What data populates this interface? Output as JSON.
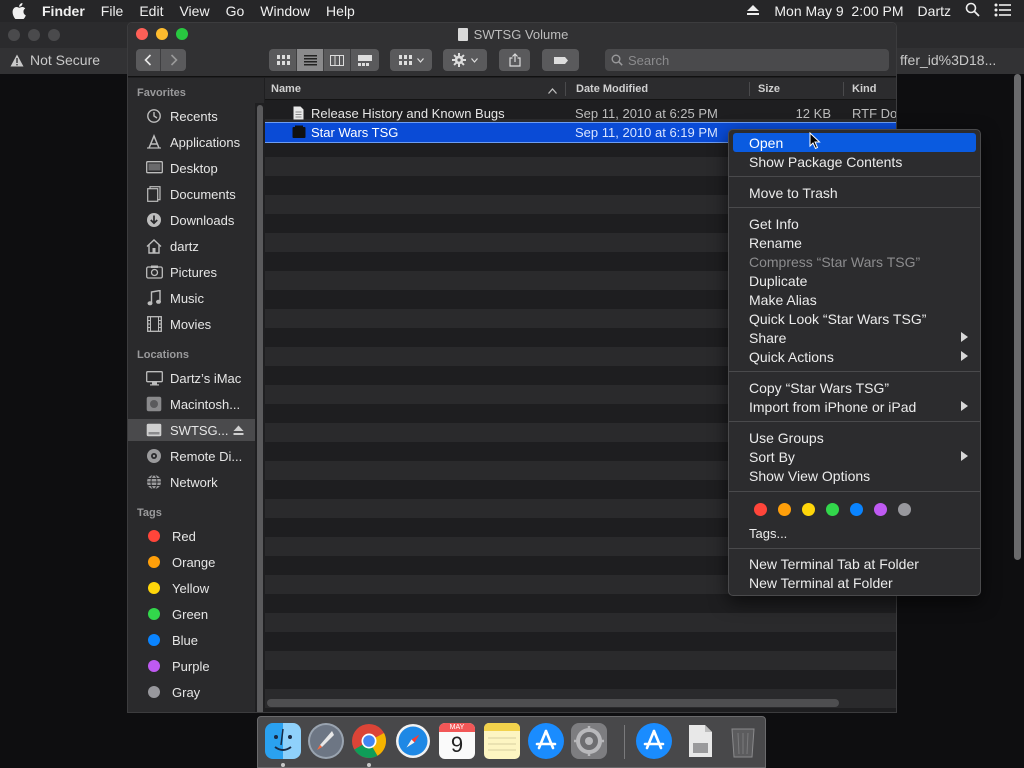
{
  "menubar": {
    "app": "Finder",
    "items": [
      "File",
      "Edit",
      "View",
      "Go",
      "Window",
      "Help"
    ],
    "datetime": "Mon May 9  2:00 PM",
    "user": "Dartz"
  },
  "browser": {
    "security": "Not Secure",
    "url_fragment": "ffer_id%3D18..."
  },
  "window": {
    "title": "SWTSG Volume",
    "search_placeholder": "Search"
  },
  "sidebar": {
    "favorites_label": "Favorites",
    "favorites": [
      {
        "label": "Recents",
        "icon": "recents-icon"
      },
      {
        "label": "Applications",
        "icon": "applications-icon"
      },
      {
        "label": "Desktop",
        "icon": "desktop-icon"
      },
      {
        "label": "Documents",
        "icon": "documents-icon"
      },
      {
        "label": "Downloads",
        "icon": "downloads-icon"
      },
      {
        "label": "dartz",
        "icon": "home-icon"
      },
      {
        "label": "Pictures",
        "icon": "pictures-icon"
      },
      {
        "label": "Music",
        "icon": "music-icon"
      },
      {
        "label": "Movies",
        "icon": "movies-icon"
      }
    ],
    "locations_label": "Locations",
    "locations": [
      {
        "label": "Dartz’s iMac",
        "icon": "imac-icon"
      },
      {
        "label": "Macintosh...",
        "icon": "hard-drive-icon"
      },
      {
        "label": "SWTSG...",
        "icon": "volume-icon",
        "selected": true
      },
      {
        "label": "Remote Di...",
        "icon": "remote-disc-icon"
      },
      {
        "label": "Network",
        "icon": "network-icon"
      }
    ],
    "tags_label": "Tags",
    "tags": [
      {
        "label": "Red",
        "color": "#ff453a"
      },
      {
        "label": "Orange",
        "color": "#ff9f0a"
      },
      {
        "label": "Yellow",
        "color": "#ffd60a"
      },
      {
        "label": "Green",
        "color": "#32d74b"
      },
      {
        "label": "Blue",
        "color": "#0a84ff"
      },
      {
        "label": "Purple",
        "color": "#bf5af2"
      },
      {
        "label": "Gray",
        "color": "#98989d"
      }
    ]
  },
  "list": {
    "columns": {
      "name": "Name",
      "date": "Date Modified",
      "size": "Size",
      "kind": "Kind"
    },
    "rows": [
      {
        "name": "Release History and Known Bugs",
        "date": "Sep 11, 2010 at 6:25 PM",
        "size": "12 KB",
        "kind": "RTF Doc"
      },
      {
        "name": "Star Wars TSG",
        "date": "Sep 11, 2010 at 6:19 PM",
        "size": "",
        "kind": "",
        "selected": true
      }
    ]
  },
  "context_menu": {
    "items": {
      "open": "Open",
      "show_package_contents": "Show Package Contents",
      "move_to_trash": "Move to Trash",
      "get_info": "Get Info",
      "rename": "Rename",
      "compress": "Compress “Star Wars TSG”",
      "duplicate": "Duplicate",
      "make_alias": "Make Alias",
      "quick_look": "Quick Look “Star Wars TSG”",
      "share": "Share",
      "quick_actions": "Quick Actions",
      "copy": "Copy “Star Wars TSG”",
      "import_iphone": "Import from iPhone or iPad",
      "use_groups": "Use Groups",
      "sort_by": "Sort By",
      "show_view_options": "Show View Options",
      "tags": "Tags...",
      "new_terminal_tab": "New Terminal Tab at Folder",
      "new_terminal": "New Terminal at Folder"
    },
    "tag_colors": [
      "#ff453a",
      "#ff9f0a",
      "#ffd60a",
      "#32d74b",
      "#0a84ff",
      "#bf5af2",
      "#98989d"
    ]
  },
  "dock": {
    "calendar_month": "MAY",
    "calendar_day": "9",
    "apps": [
      "finder-icon",
      "launchpad-icon",
      "chrome-icon",
      "safari-icon",
      "calendar-icon",
      "notes-icon",
      "app-store-icon",
      "system-preferences-icon",
      "app-store-icon",
      "document-icon",
      "trash-icon"
    ]
  },
  "colors": {
    "accent": "#0a5be0",
    "selection": "#0a4bd6"
  }
}
